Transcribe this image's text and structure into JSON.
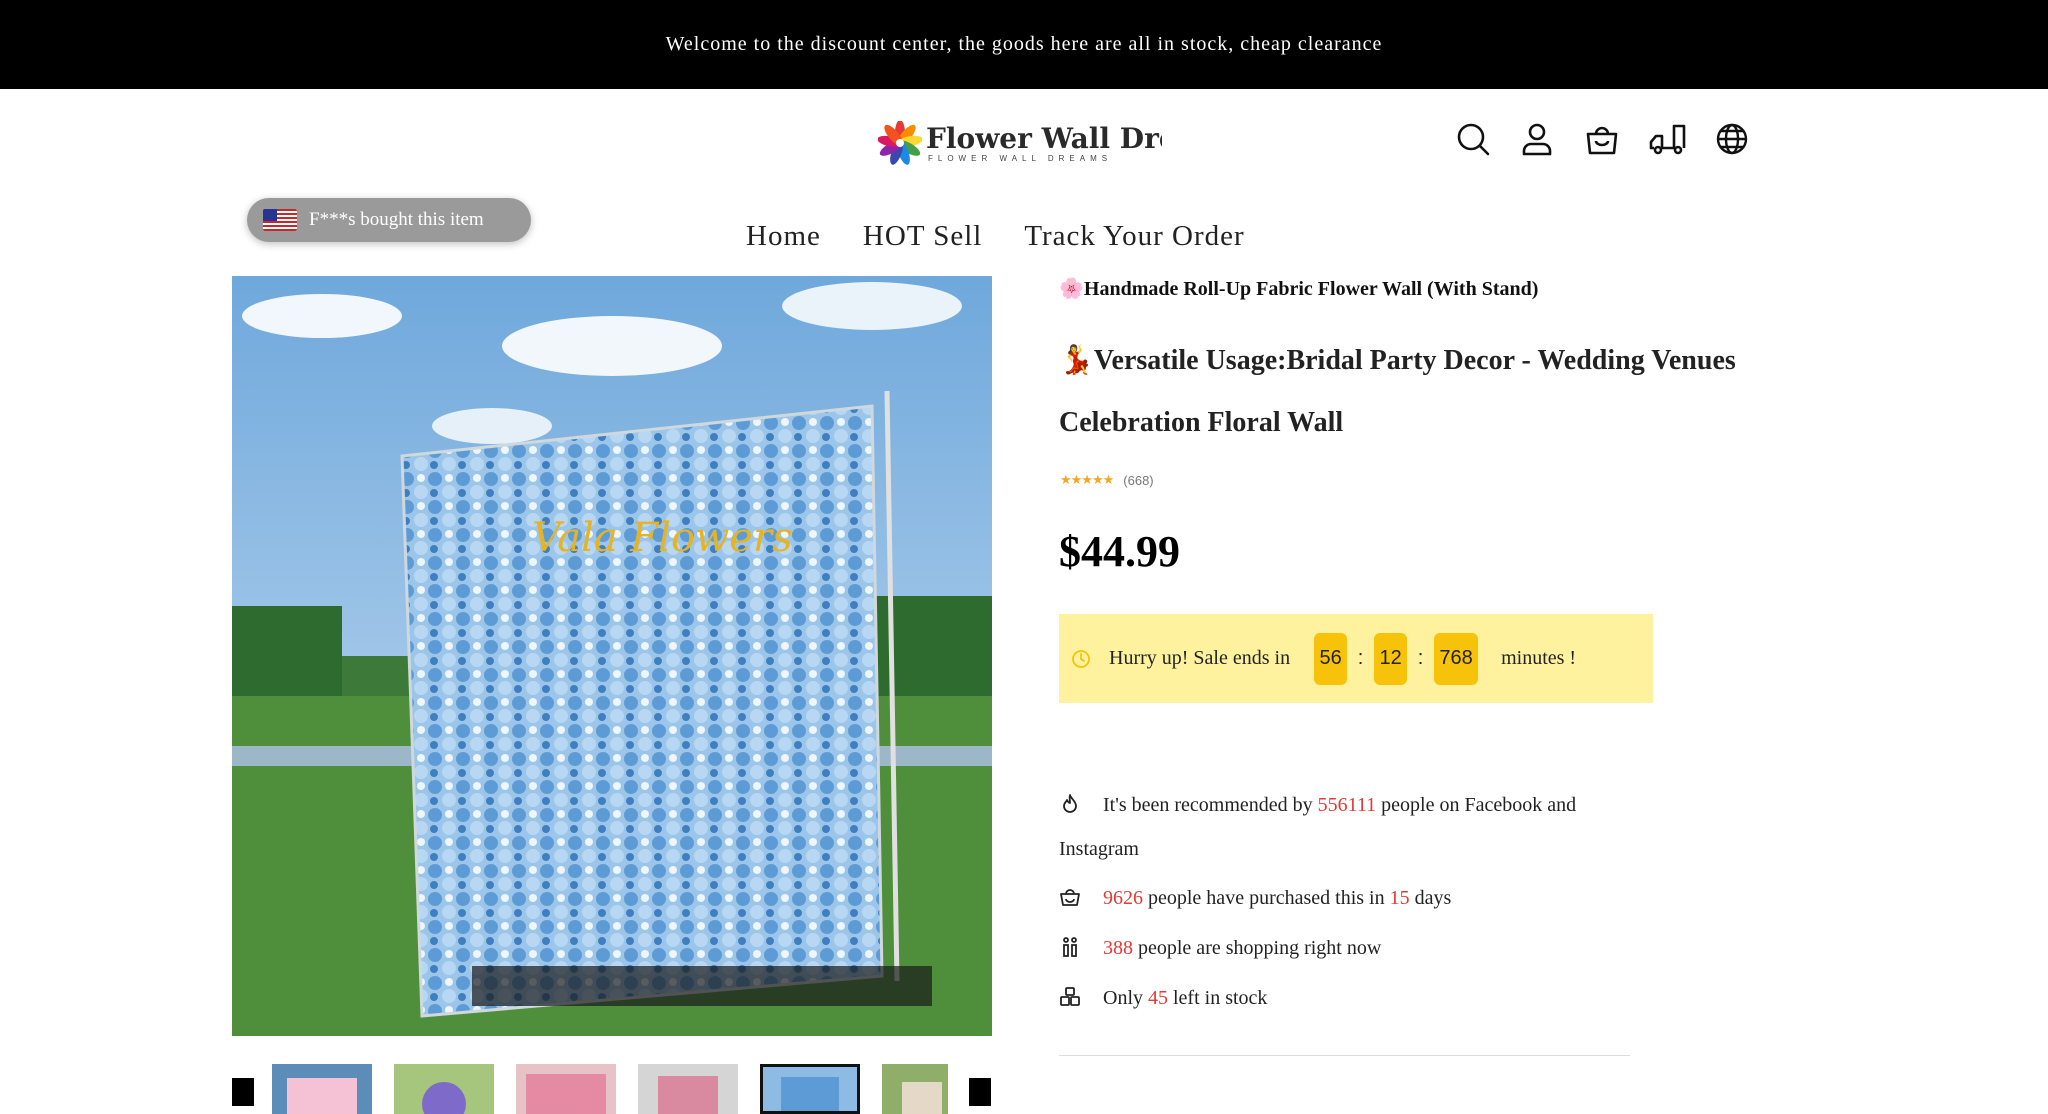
{
  "announcement": "Welcome to the discount center, the goods here are all in stock, cheap clearance",
  "brand": {
    "name": "Flower Wall Dream",
    "tagline": "FLOWER WALL DREAMS"
  },
  "header_icons": [
    "search-icon",
    "account-icon",
    "cart-icon",
    "track-order-icon",
    "language-icon"
  ],
  "toast": {
    "text": "F***s bought this item"
  },
  "nav": {
    "home": "Home",
    "hot_sell": "HOT Sell",
    "track_order": "Track Your Order"
  },
  "gallery": {
    "watermark": "Vala Flowers",
    "thumbnail_count": 6,
    "active_thumbnail": 5
  },
  "product": {
    "title_line1": "🌸Handmade Roll-Up Fabric Flower Wall (With Stand)",
    "title_line2": "💃Versatile Usage:Bridal Party Decor - Wedding Venues Celebration Floral Wall",
    "stars": "★★★★★",
    "rating_count": "(668)",
    "price": "$44.99"
  },
  "sale": {
    "prefix": "Hurry up! Sale ends in",
    "cd1": "56",
    "cd2": "12",
    "cd3": "768",
    "sep": ":",
    "suffix": "minutes !",
    "box_color": "#fff29e",
    "digit_color": "#f7c20a"
  },
  "stats": {
    "rec_pre": "It's been recommended by",
    "rec_num": "556111",
    "rec_post": "people on Facebook and Instagram",
    "pur_num": "9626",
    "pur_mid": "people have purchased this in",
    "pur_days": "15",
    "pur_post": "days",
    "shop_num": "388",
    "shop_post": "people are shopping right now",
    "stock_pre": "Only",
    "stock_num": "45",
    "stock_post": "left in stock",
    "highlight_color": "#e53935"
  }
}
